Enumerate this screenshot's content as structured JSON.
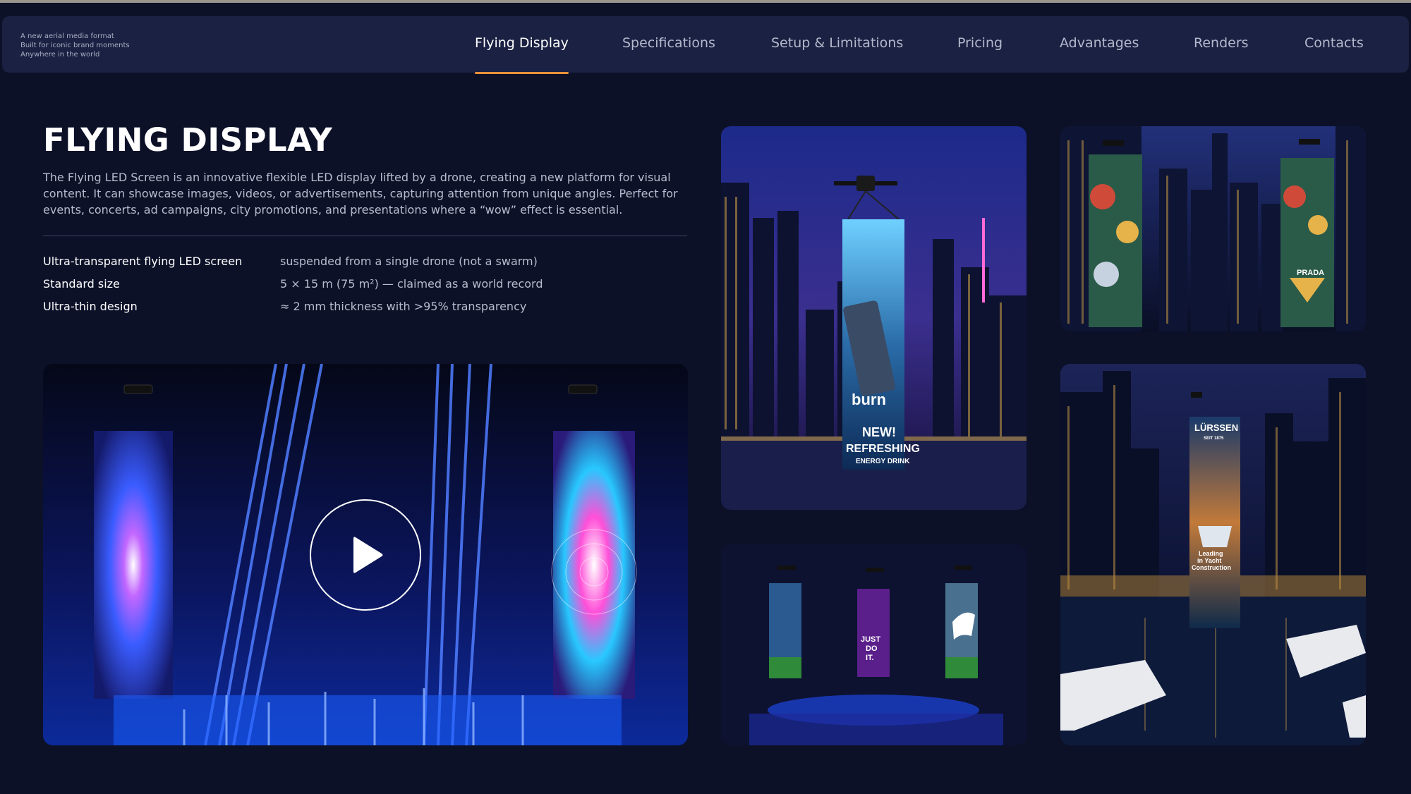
{
  "nav": {
    "tagline": [
      "A new aerial media format",
      "Built for iconic brand moments",
      "Anywhere in the world"
    ],
    "items": [
      {
        "label": "Flying Display",
        "active": true
      },
      {
        "label": "Specifications"
      },
      {
        "label": "Setup & Limitations"
      },
      {
        "label": "Pricing"
      },
      {
        "label": "Advantages"
      },
      {
        "label": "Renders"
      },
      {
        "label": "Contacts"
      }
    ],
    "accent_color": "#e8913a"
  },
  "main": {
    "title": "FLYING DISPLAY",
    "intro": "The Flying LED Screen is an innovative flexible LED display lifted by a drone, creating a new platform for visual content. It can showcase images, videos, or advertisements, capturing attention from unique angles. Perfect for events, concerts, ad campaigns, city promotions, and presentations where a “wow” effect is essential.",
    "specs": [
      {
        "key": "Ultra-transparent flying LED screen",
        "value": "suspended from a single drone (not a swarm)"
      },
      {
        "key": "Standard size",
        "value": "5 × 15 m (75 m²) — claimed as a world record"
      },
      {
        "key": "Ultra-thin design",
        "value": "≈ 2 mm thickness with >95% transparency"
      }
    ]
  },
  "media": {
    "video_play_icon": "play-icon",
    "render1_screen": [
      "burn",
      "NEW!",
      "REFRESHING",
      "ENERGY DRINK"
    ],
    "render2_screen": [
      "PRADA"
    ],
    "render3_screen": [
      "JUST",
      "DO",
      "IT."
    ],
    "render4_screen": [
      "LÜRSSEN",
      "SEIT 1875",
      "Leading",
      "in Yacht",
      "Construction"
    ]
  }
}
